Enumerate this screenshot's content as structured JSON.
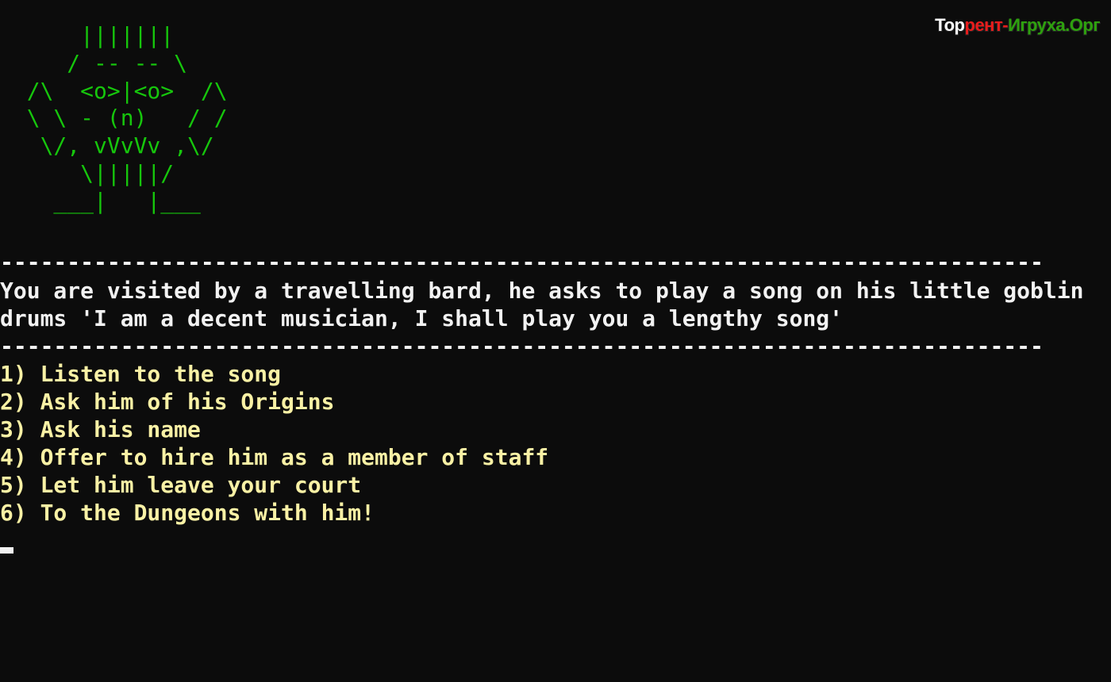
{
  "watermark": {
    "part1": "Тор",
    "part2": "рент-",
    "part3": "Игруха.Орг"
  },
  "ascii_art": "      |||||||\n     / -- -- \\\n  /\\  <o>|<o>  /\\\n  \\ \\ - (n)   / /\n   \\/, vVvVv ,\\/\n      \\|||||/\n    ___|   |___",
  "separator": "------------------------------------------------------------------------------",
  "event_text": {
    "line1": "You are visited by a travelling bard, he asks to play a song on his little goblin",
    "line2": "drums 'I am a decent musician, I shall play you a lengthy song'"
  },
  "options": [
    "1) Listen to the song",
    "2) Ask him of his Origins",
    "3) Ask his name",
    "4) Offer to hire him as a member of staff",
    "5) Let him leave your court",
    "6) To the Dungeons with him!"
  ],
  "colors": {
    "background": "#0c0c0c",
    "art": "#16c60c",
    "text": "#f2f2f2",
    "options": "#f9f1a5",
    "cursor": "#f2f2f2",
    "watermark_red": "#e81c1c",
    "watermark_green": "#2ea10e"
  }
}
